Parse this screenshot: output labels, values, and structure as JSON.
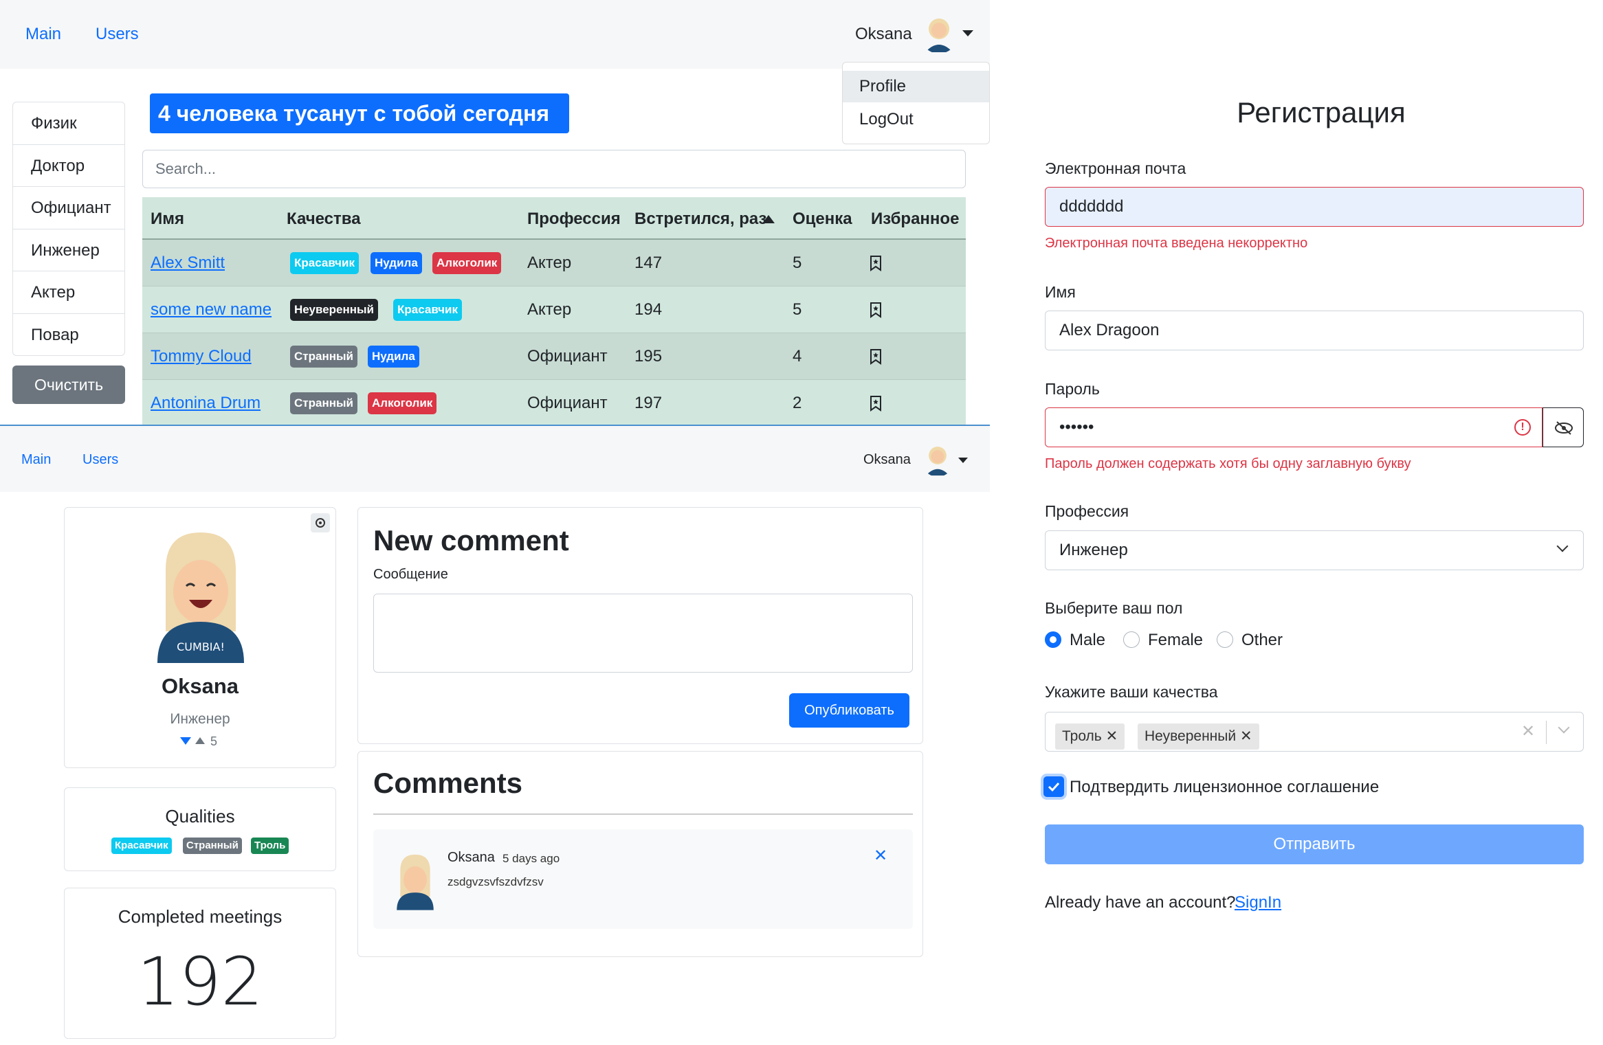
{
  "users_page": {
    "nav": {
      "main": "Main",
      "users": "Users",
      "user_name": "Oksana"
    },
    "dropdown": {
      "profile": "Profile",
      "logout": "LogOut"
    },
    "professions": [
      "Физик",
      "Доктор",
      "Официант",
      "Инженер",
      "Актер",
      "Повар"
    ],
    "clear_button": "Очистить",
    "banner": "4 человека тусанут с тобой сегодня",
    "search_placeholder": "Search...",
    "table": {
      "headers": [
        "Имя",
        "Качества",
        "Профессия",
        "Встретился, раз",
        "Оценка",
        "Избранное"
      ],
      "rows": [
        {
          "name": "Alex Smitt",
          "qualities": [
            "Красавчик",
            "Нудила",
            "Алкоголик"
          ],
          "profession": "Актер",
          "meetings": "147",
          "rate": "5"
        },
        {
          "name": "some new name",
          "qualities": [
            "Неуверенный",
            "Красавчик"
          ],
          "profession": "Актер",
          "meetings": "194",
          "rate": "5"
        },
        {
          "name": "Tommy Cloud",
          "qualities": [
            "Странный",
            "Нудила"
          ],
          "profession": "Официант",
          "meetings": "195",
          "rate": "4"
        },
        {
          "name": "Antonina Drum",
          "qualities": [
            "Странный",
            "Алкоголик"
          ],
          "profession": "Официант",
          "meetings": "197",
          "rate": "2"
        }
      ]
    }
  },
  "user_page": {
    "nav": {
      "main": "Main",
      "users": "Users",
      "user_name": "Oksana"
    },
    "profile": {
      "name": "Oksana",
      "profession": "Инженер",
      "rate": "5",
      "avatar_text": "CUMBIA!"
    },
    "qualities": {
      "title": "Qualities",
      "items": [
        "Красавчик",
        "Странный",
        "Троль"
      ]
    },
    "meetings": {
      "title": "Completed meetings",
      "value": "192"
    },
    "new_comment": {
      "title": "New comment",
      "label": "Сообщение",
      "button": "Опубликовать"
    },
    "comments": {
      "title": "Comments",
      "items": [
        {
          "author": "Oksana",
          "time": "5 days ago",
          "text": "zsdgvzsvfszdvfzsv"
        }
      ]
    }
  },
  "register": {
    "title": "Регистрация",
    "email": {
      "label": "Электронная почта",
      "value": "ddddddd",
      "error": "Электронная почта введена некорректно"
    },
    "name": {
      "label": "Имя",
      "value": "Alex Dragoon"
    },
    "password": {
      "label": "Пароль",
      "value": "••••••",
      "error": "Пароль должен содержать хотя бы одну заглавную букву"
    },
    "profession": {
      "label": "Профессия",
      "value": "Инженер"
    },
    "sex": {
      "label": "Выберите ваш пол",
      "options": [
        "Male",
        "Female",
        "Other"
      ],
      "selected": "Male"
    },
    "qualities": {
      "label": "Укажите ваши качества",
      "selected": [
        "Троль",
        "Неуверенный"
      ]
    },
    "license": {
      "label": "Подтвердить лицензионное соглашение",
      "checked": true
    },
    "submit": "Отправить",
    "signin_prompt": "Already have an account?",
    "signin_link": "SignIn"
  },
  "colors": {
    "primary": "#0d6efd",
    "danger": "#dc3545",
    "info": "#0dcaf0",
    "secondary": "#6c757d",
    "success": "#198754",
    "table_bg": "#d1e7dd"
  }
}
